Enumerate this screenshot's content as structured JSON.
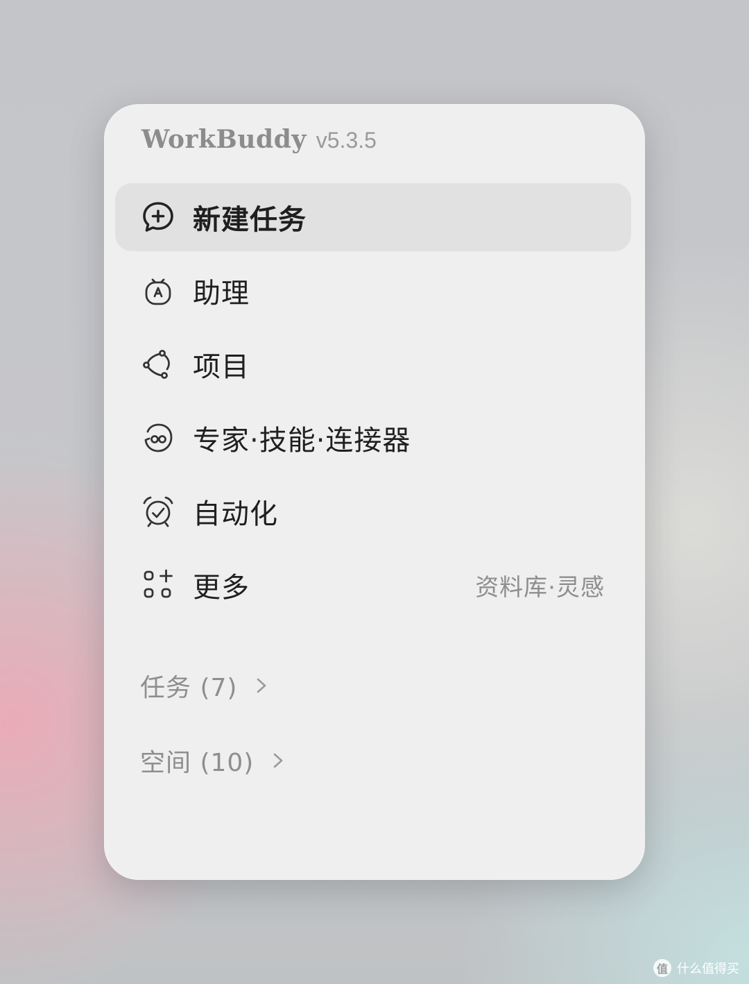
{
  "app": {
    "name": "WorkBuddy",
    "version": "v5.3.5"
  },
  "menu": {
    "items": [
      {
        "label": "新建任务",
        "icon": "chat-plus-icon",
        "selected": true
      },
      {
        "label": "助理",
        "icon": "assistant-robot-icon"
      },
      {
        "label": "项目",
        "icon": "project-nodes-icon"
      },
      {
        "label": "专家·技能·连接器",
        "icon": "expert-skill-icon"
      },
      {
        "label": "自动化",
        "icon": "alarm-check-icon"
      },
      {
        "label": "更多",
        "icon": "apps-plus-icon",
        "hint": "资料库·灵感"
      }
    ]
  },
  "sections": [
    {
      "label": "任务 (7)"
    },
    {
      "label": "空间 (10)"
    }
  ],
  "watermark": {
    "badge": "值",
    "text": "什么值得买"
  },
  "colors": {
    "panel_bg": "#efefef",
    "selected_bg": "#e1e1e1",
    "text_primary": "#1f1f1f",
    "text_secondary": "#8e8e8e"
  }
}
